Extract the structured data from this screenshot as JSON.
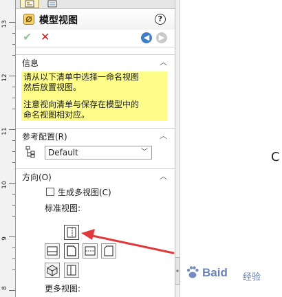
{
  "ruler": {
    "numbers": [
      "13",
      "12",
      "11",
      "10",
      "9",
      "8"
    ]
  },
  "header": {
    "title": "模型视图"
  },
  "sections": {
    "info": {
      "label": "信息",
      "line1a": "请从以下清单中选择一命名视图",
      "line1b": "然后放置视图。",
      "line2a": "注意视向清单与保存在模型中的",
      "line2b": "命名视图相对应。"
    },
    "reference_config": {
      "label": "参考配置(R)",
      "selected": "Default"
    },
    "orientation": {
      "label": "方向(O)",
      "checkbox_label": "生成多视图(C)",
      "checkbox_checked": false,
      "standard_views_label": "标准视图:",
      "more_views_label": "更多视图:"
    }
  },
  "canvas": {
    "glyph": "C"
  },
  "watermark": {
    "brand": "Baid",
    "suffix": "经验"
  },
  "colors": {
    "info_bg": "#fefd8a",
    "annotation_arrow": "#e0393b",
    "ok": "#9bc49b",
    "cancel": "#c81e1e",
    "nav_back": "#3d7dca"
  }
}
